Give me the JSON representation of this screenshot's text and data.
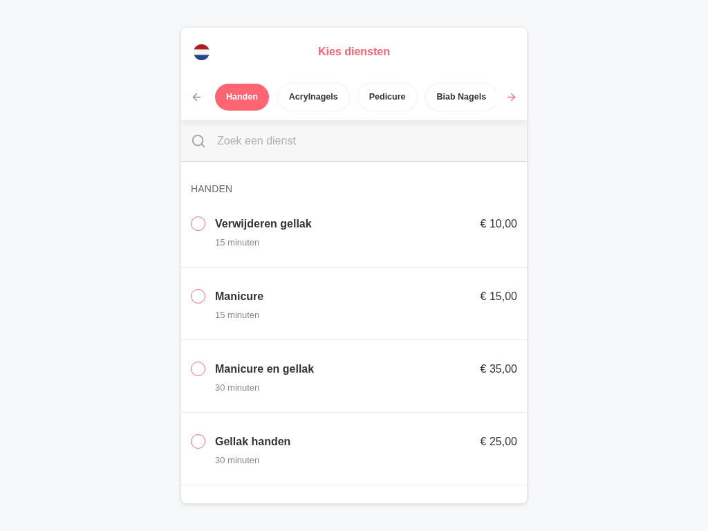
{
  "header": {
    "title": "Kies diensten"
  },
  "nav": {
    "previous": {
      "disabled": true
    },
    "next": {
      "disabled": false
    }
  },
  "categories": [
    {
      "label": "Handen",
      "selected": true
    },
    {
      "label": "Acrylnagels",
      "selected": false
    },
    {
      "label": "Pedicure",
      "selected": false
    },
    {
      "label": "Biab Nagels",
      "selected": false
    }
  ],
  "search": {
    "placeholder": "Zoek een dienst"
  },
  "section": {
    "title": "HANDEN"
  },
  "services": [
    {
      "name": "Verwijderen gellak",
      "duration": "15 minuten",
      "price": "€ 10,00",
      "selected": false
    },
    {
      "name": "Manicure",
      "duration": "15 minuten",
      "price": "€ 15,00",
      "selected": false
    },
    {
      "name": "Manicure en gellak",
      "duration": "30 minuten",
      "price": "€ 35,00",
      "selected": false
    },
    {
      "name": "Gellak handen",
      "duration": "30 minuten",
      "price": "€ 25,00",
      "selected": false
    }
  ]
}
